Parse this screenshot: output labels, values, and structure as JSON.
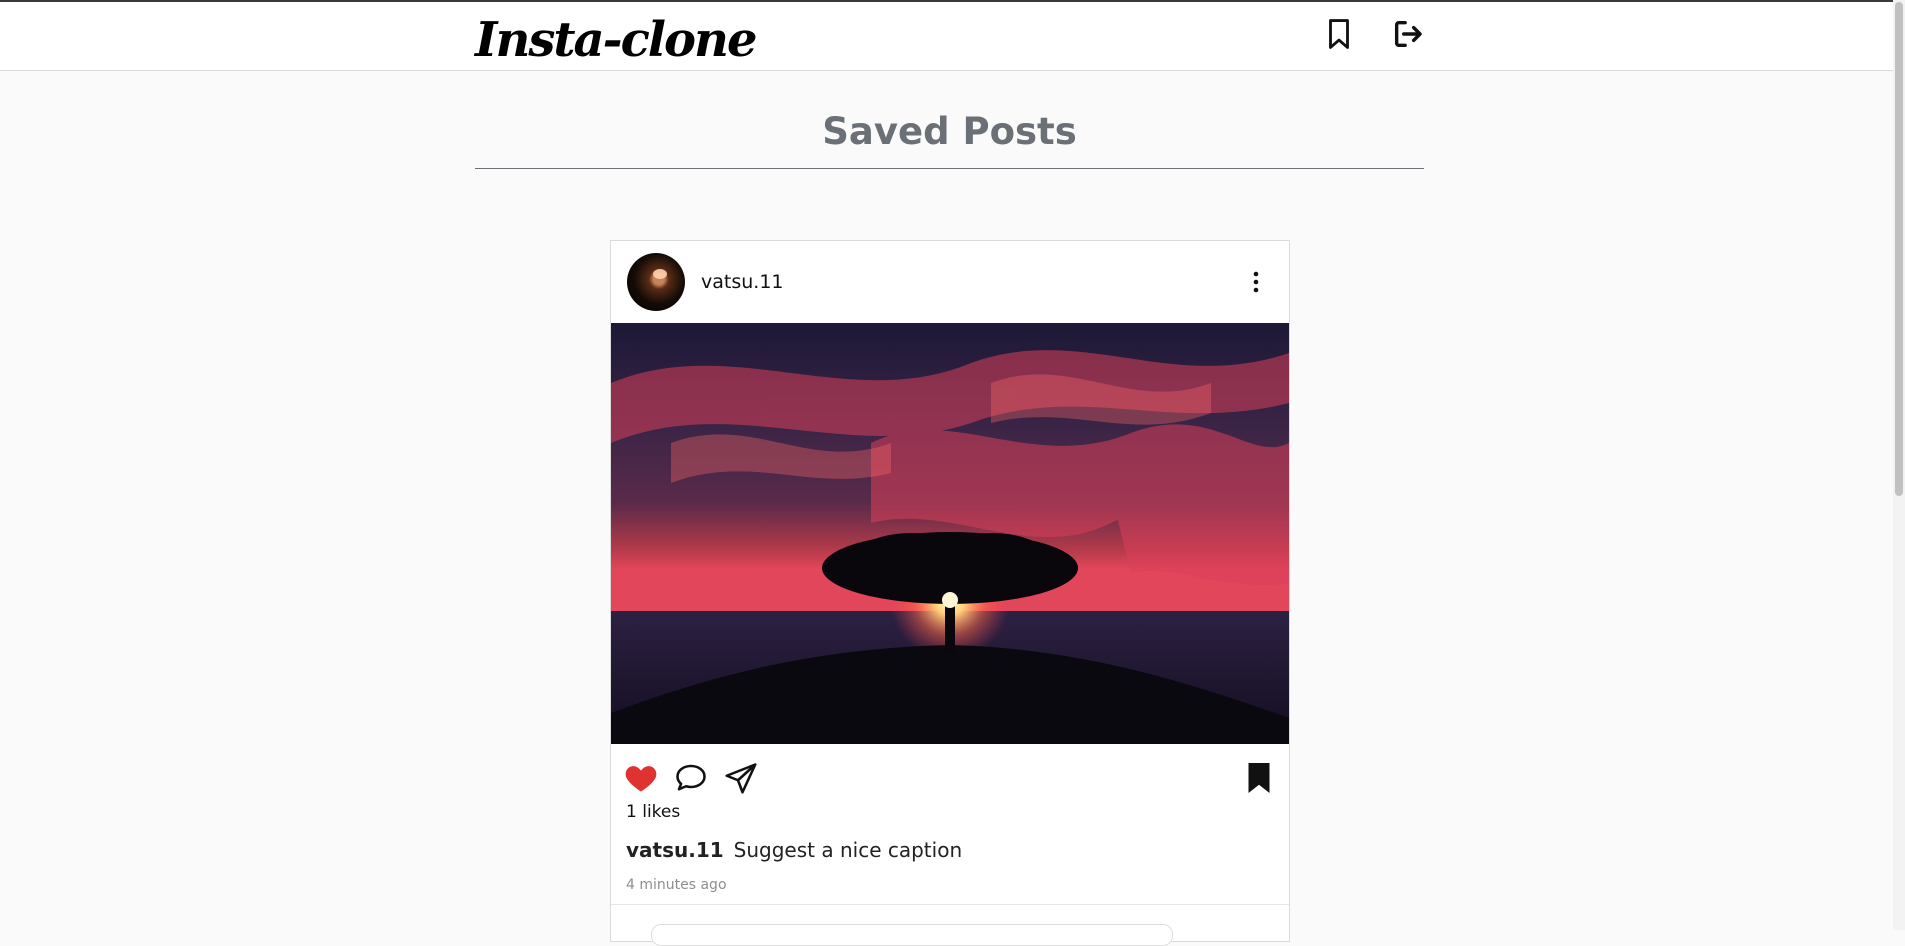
{
  "navbar": {
    "logo": "Insta-clone",
    "icons": [
      "bookmark-icon",
      "logout-icon"
    ]
  },
  "page": {
    "title": "Saved Posts"
  },
  "post": {
    "username": "vatsu.11",
    "likes": "1 likes",
    "caption_user": "vatsu.11",
    "caption": "Suggest a nice caption",
    "time": "4 minutes ago",
    "liked": true,
    "saved": true
  },
  "colors": {
    "background": "#fafafa",
    "title": "#6b6f76",
    "heart": "#e0322e",
    "muted": "#8e8e8e"
  }
}
